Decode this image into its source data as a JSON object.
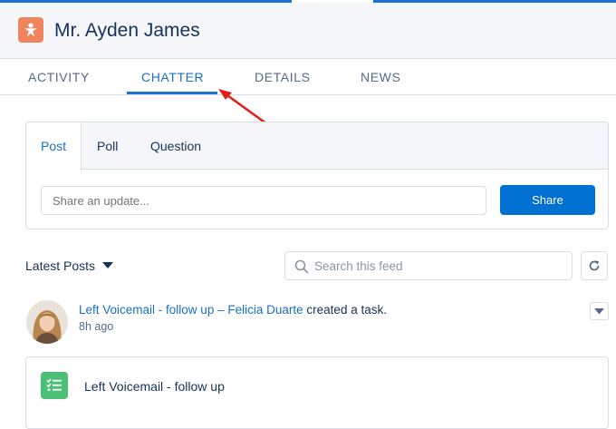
{
  "header": {
    "title": "Mr. Ayden James",
    "icon": "lead-icon",
    "icon_color": "#f0855d"
  },
  "tabs": [
    {
      "label": "ACTIVITY",
      "active": false
    },
    {
      "label": "CHATTER",
      "active": true
    },
    {
      "label": "DETAILS",
      "active": false
    },
    {
      "label": "NEWS",
      "active": false
    }
  ],
  "annotation": {
    "arrow_color": "#e0201b",
    "points_to": "CHATTER"
  },
  "publisher": {
    "tabs": [
      {
        "label": "Post",
        "active": true
      },
      {
        "label": "Poll",
        "active": false
      },
      {
        "label": "Question",
        "active": false
      }
    ],
    "input_placeholder": "Share an update...",
    "share_label": "Share",
    "share_color": "#0070d2"
  },
  "feed": {
    "filter_label": "Latest Posts",
    "search_placeholder": "Search this feed",
    "posts": [
      {
        "subject": "Left Voicemail - follow up",
        "separator": "–",
        "actor": "Felicia Duarte",
        "action": "created a task.",
        "time": "8h ago",
        "task_title": "Left Voicemail - follow up",
        "task_icon": "task-icon",
        "task_icon_color": "#4bc076"
      }
    ]
  },
  "colors": {
    "accent": "#1b72d3",
    "link": "#1b6fc2",
    "text": "#16325c",
    "muted": "#54698d",
    "border": "#d8dde6"
  }
}
